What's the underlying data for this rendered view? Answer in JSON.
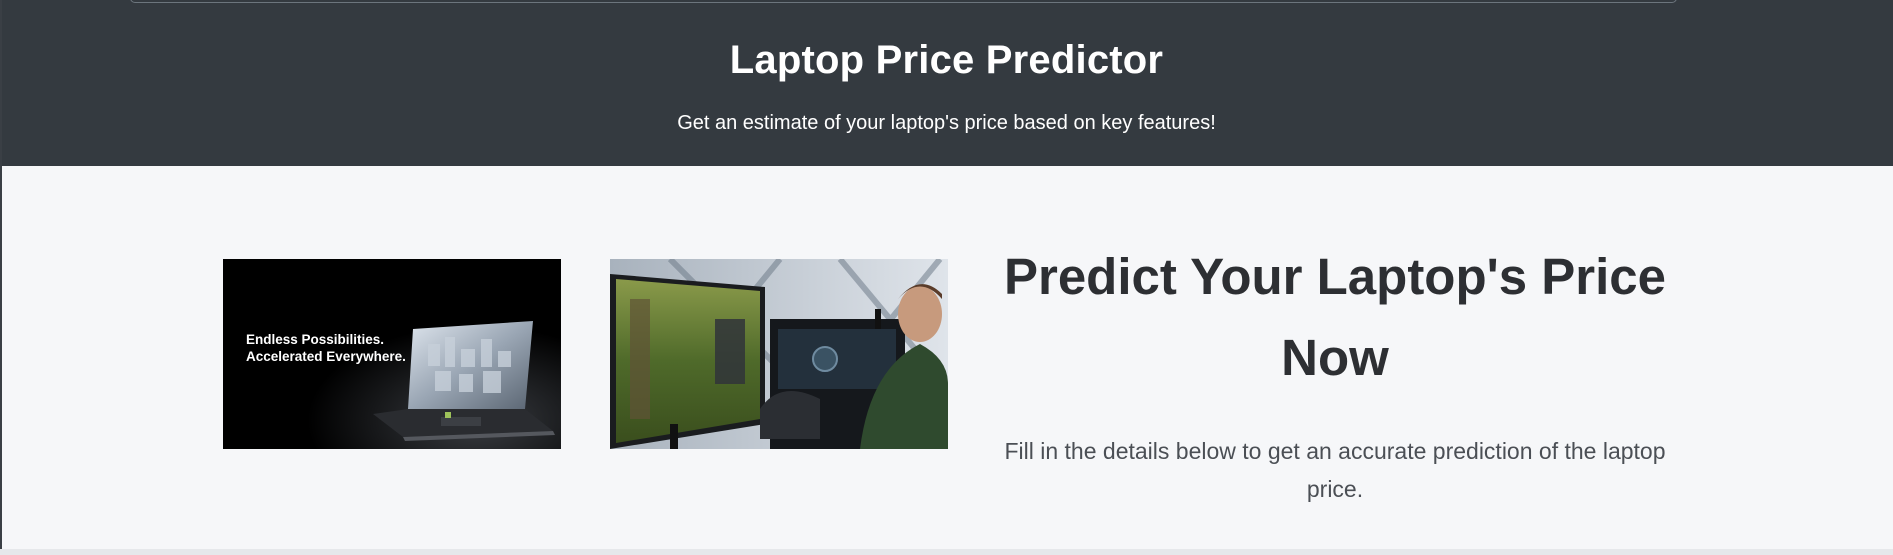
{
  "header": {
    "title": "Laptop Price Predictor",
    "subtitle": "Get an estimate of your laptop's price based on key features!"
  },
  "hero": {
    "image1": {
      "tagline_line1": "Endless Possibilities.",
      "tagline_line2": "Accelerated Everywhere."
    },
    "heading": "Predict Your Laptop's Price Now",
    "description": "Fill in the details below to get an accurate prediction of the laptop price."
  },
  "colors": {
    "header_bg": "#343a40",
    "page_bg": "#f6f7f9",
    "heading_text": "#2d2f33",
    "body_text": "#4b4f55"
  }
}
